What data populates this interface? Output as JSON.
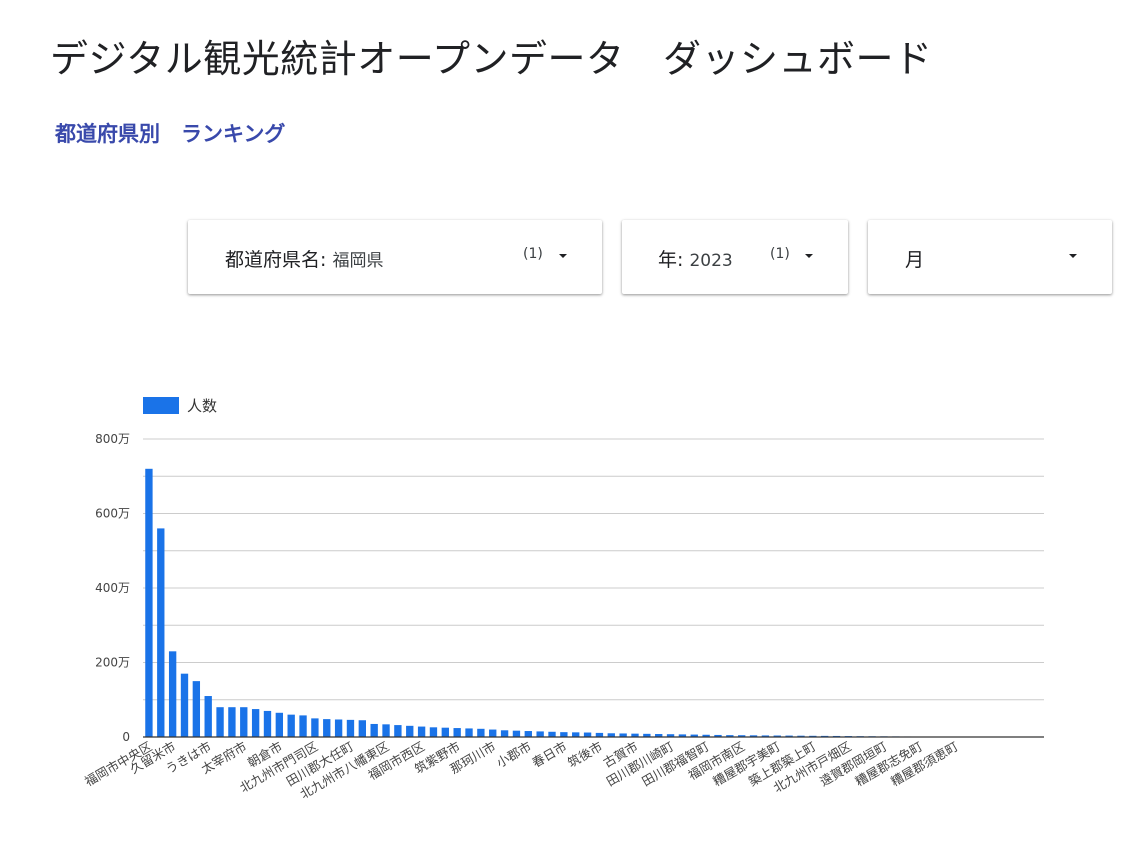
{
  "header": {
    "title": "デジタル観光統計オープンデータ　ダッシュボード",
    "subtitle": "都道府県別　ランキング"
  },
  "filters": {
    "prefecture": {
      "label": "都道府県名",
      "value": "福岡県",
      "count": "(1)"
    },
    "year": {
      "label": "年",
      "value": "2023",
      "count": "(1)"
    },
    "month": {
      "label": "月"
    }
  },
  "colors": {
    "bar": "#1a73e8",
    "subtitle": "#3949ab",
    "grid": "#cccccc",
    "axis": "#333333"
  },
  "chart_data": {
    "type": "bar",
    "legend": [
      "人数"
    ],
    "legend_position": "top-left",
    "grid": true,
    "ylim": [
      0,
      8000000
    ],
    "y_ticks": [
      {
        "value": 0,
        "label": "0"
      },
      {
        "value": 2000000,
        "label": "200万"
      },
      {
        "value": 4000000,
        "label": "400万"
      },
      {
        "value": 6000000,
        "label": "600万"
      },
      {
        "value": 8000000,
        "label": "800万"
      }
    ],
    "x_tick_labels": [
      {
        "index": 0,
        "label": "福岡市中央区"
      },
      {
        "index": 2,
        "label": "久留米市"
      },
      {
        "index": 5,
        "label": "うきは市"
      },
      {
        "index": 8,
        "label": "太宰府市"
      },
      {
        "index": 11,
        "label": "朝倉市"
      },
      {
        "index": 14,
        "label": "北九州市門司区"
      },
      {
        "index": 17,
        "label": "田川郡大任町"
      },
      {
        "index": 20,
        "label": "北九州市八幡東区"
      },
      {
        "index": 23,
        "label": "福岡市西区"
      },
      {
        "index": 26,
        "label": "筑紫野市"
      },
      {
        "index": 29,
        "label": "那珂川市"
      },
      {
        "index": 32,
        "label": "小郡市"
      },
      {
        "index": 35,
        "label": "春日市"
      },
      {
        "index": 38,
        "label": "筑後市"
      },
      {
        "index": 41,
        "label": "古賀市"
      },
      {
        "index": 44,
        "label": "田川郡川崎町"
      },
      {
        "index": 47,
        "label": "田川郡福智町"
      },
      {
        "index": 50,
        "label": "福岡市南区"
      },
      {
        "index": 53,
        "label": "糟屋郡宇美町"
      },
      {
        "index": 56,
        "label": "築上郡築上町"
      },
      {
        "index": 59,
        "label": "北九州市戸畑区"
      },
      {
        "index": 62,
        "label": "遠賀郡岡垣町"
      },
      {
        "index": 65,
        "label": "糟屋郡志免町"
      },
      {
        "index": 68,
        "label": "糟屋郡須恵町"
      }
    ],
    "series": [
      {
        "name": "人数",
        "values": [
          7200000,
          5600000,
          2300000,
          1700000,
          1500000,
          1100000,
          800000,
          800000,
          800000,
          750000,
          700000,
          650000,
          600000,
          580000,
          500000,
          480000,
          470000,
          460000,
          450000,
          350000,
          340000,
          320000,
          300000,
          280000,
          260000,
          250000,
          240000,
          230000,
          220000,
          200000,
          180000,
          170000,
          160000,
          150000,
          140000,
          130000,
          125000,
          120000,
          110000,
          100000,
          95000,
          90000,
          85000,
          80000,
          75000,
          70000,
          65000,
          60000,
          55000,
          50000,
          48000,
          45000,
          42000,
          40000,
          38000,
          35000,
          32000,
          30000,
          28000,
          25000,
          22000,
          20000,
          18000,
          16000,
          14000,
          12000,
          10000,
          8000,
          6000,
          5000,
          4000,
          3000,
          2500,
          2000,
          1500,
          1000
        ]
      }
    ]
  }
}
